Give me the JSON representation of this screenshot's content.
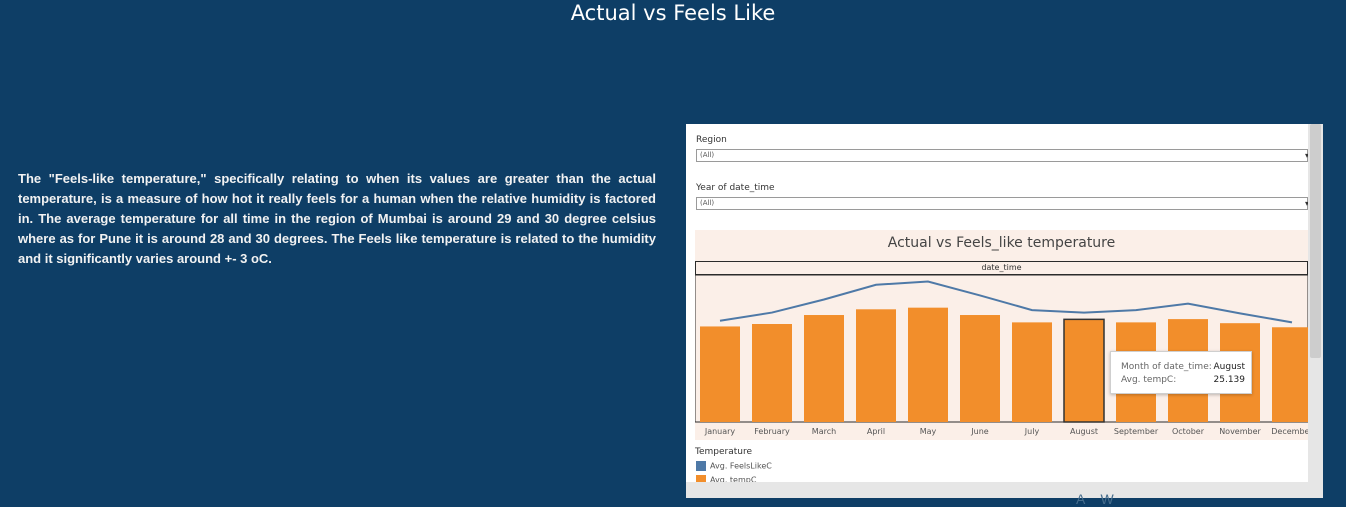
{
  "page": {
    "title": "Actual vs Feels Like",
    "description": "The \"Feels-like temperature,\" specifically relating to when its values are greater than the actual temperature, is a measure of how hot it really feels for a human when the relative humidity is factored in. The average temperature for all time in the region of Mumbai is around 29 and 30 degree celsius where as for Pune it is around 28 and 30 degrees. The Feels like temperature is related to the humidity and it significantly varies around +- 3 oC.",
    "bottom_fragment": "A  W"
  },
  "filters": {
    "region": {
      "label": "Region",
      "value": "(All)"
    },
    "year": {
      "label": "Year of date_time",
      "value": "(All)"
    }
  },
  "icons": {
    "dropdown": "chevron-down-icon"
  },
  "colors": {
    "background": "#0e3e66",
    "bar": "#f28e2b",
    "line": "#4e79a7",
    "panel": "#fbefe8"
  },
  "tooltip": {
    "row1_label": "Month of date_time:",
    "row1_value": "August",
    "row2_label": "Avg. tempC:",
    "row2_value": "25.139"
  },
  "legend": {
    "title": "Temperature",
    "items": [
      {
        "label": "Avg. FeelsLikeC",
        "color": "#4e79a7"
      },
      {
        "label": "Avg. tempC",
        "color": "#f28e2b"
      }
    ]
  },
  "chart_data": {
    "type": "bar",
    "title": "Actual vs Feels_like temperature",
    "column_header": "date_time",
    "categories": [
      "January",
      "February",
      "March",
      "April",
      "May",
      "June",
      "July",
      "August",
      "September",
      "October",
      "November",
      "December"
    ],
    "series": [
      {
        "name": "Avg. tempC",
        "type": "bar",
        "values": [
          23.4,
          24.0,
          26.2,
          27.6,
          28.0,
          26.2,
          24.4,
          25.139,
          24.4,
          25.2,
          24.2,
          23.2
        ]
      },
      {
        "name": "Avg. FeelsLikeC",
        "type": "line",
        "values": [
          24.8,
          26.8,
          30.0,
          33.6,
          34.4,
          31.0,
          27.4,
          26.8,
          27.4,
          29.0,
          26.6,
          24.4
        ]
      }
    ],
    "ylim": [
      0,
      36
    ],
    "highlighted_category": "August",
    "grid": false,
    "legend_position": "bottom-left"
  }
}
